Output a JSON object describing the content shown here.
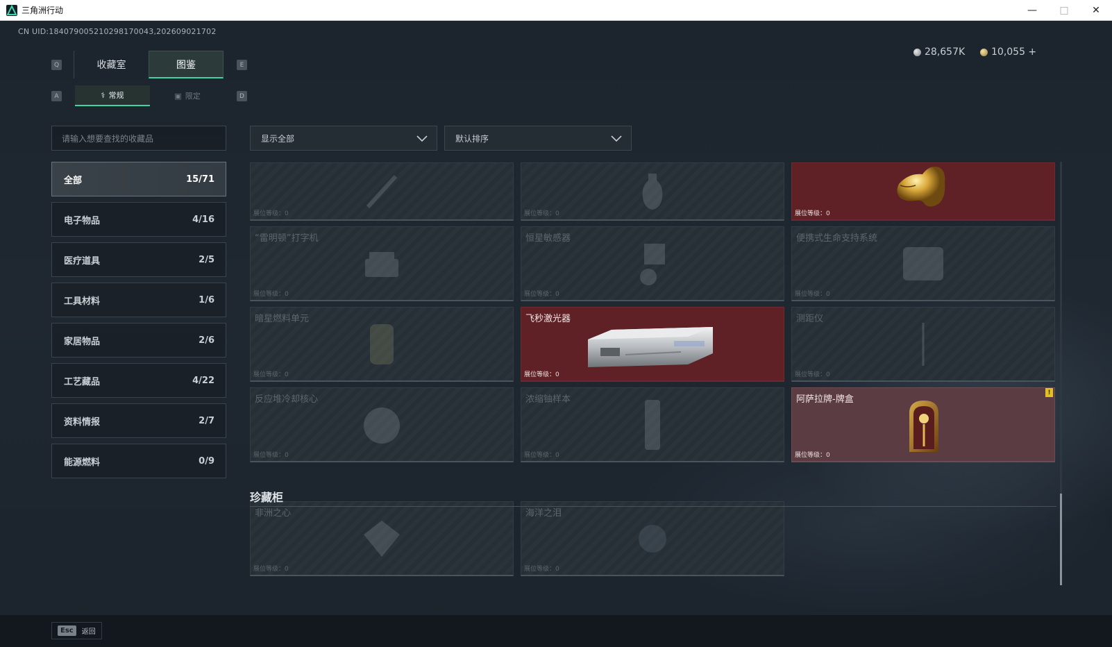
{
  "window": {
    "title": "三角洲行动"
  },
  "header": {
    "uid": "CN UID:184079005210298170043,202609021702",
    "currency1": "28,657K",
    "currency2": "10,055 +"
  },
  "keys": {
    "prev_tab": "Q",
    "next_tab": "E",
    "prev_sub": "A",
    "next_sub": "D"
  },
  "tabs": [
    {
      "label": "收藏室",
      "active": false
    },
    {
      "label": "图鉴",
      "active": true
    }
  ],
  "subtabs": [
    {
      "label": "常规",
      "active": true
    },
    {
      "label": "限定",
      "active": false
    }
  ],
  "search": {
    "placeholder": "请输入想要查找的收藏品"
  },
  "filters": {
    "show": "显示全部",
    "sort": "默认排序"
  },
  "categories": [
    {
      "label": "全部",
      "count": "15/71",
      "active": true
    },
    {
      "label": "电子物品",
      "count": "4/16"
    },
    {
      "label": "医疗道具",
      "count": "2/5"
    },
    {
      "label": "工具材料",
      "count": "1/6"
    },
    {
      "label": "家居物品",
      "count": "2/6"
    },
    {
      "label": "工艺藏品",
      "count": "4/22"
    },
    {
      "label": "资料情报",
      "count": "2/7"
    },
    {
      "label": "能源燃料",
      "count": "0/9"
    }
  ],
  "level_label": "展位等级：0",
  "cards": [
    {
      "name": "",
      "owned": false
    },
    {
      "name": "",
      "owned": false
    },
    {
      "name": "",
      "owned": true,
      "color": "red",
      "icon": "golden-crocodile-head"
    },
    {
      "name": "“雷明顿”打字机",
      "owned": false
    },
    {
      "name": "恒星敏感器",
      "owned": false
    },
    {
      "name": "便携式生命支持系统",
      "owned": false
    },
    {
      "name": "暗星燃料单元",
      "owned": false
    },
    {
      "name": "飞秒激光器",
      "owned": true,
      "color": "red",
      "icon": "laser-device"
    },
    {
      "name": "测距仪",
      "owned": false
    },
    {
      "name": "反应堆冷却核心",
      "owned": false
    },
    {
      "name": "浓缩铀样本",
      "owned": false
    },
    {
      "name": "阿萨拉牌-牌盒",
      "owned": true,
      "color": "rose",
      "icon": "card-box",
      "warning": "!"
    }
  ],
  "showcase": {
    "title": "珍藏柜",
    "cards": [
      {
        "name": "非洲之心",
        "owned": false
      },
      {
        "name": "海洋之泪",
        "owned": false
      }
    ]
  },
  "footer": {
    "esc_key": "Esc",
    "esc_label": "返回"
  }
}
